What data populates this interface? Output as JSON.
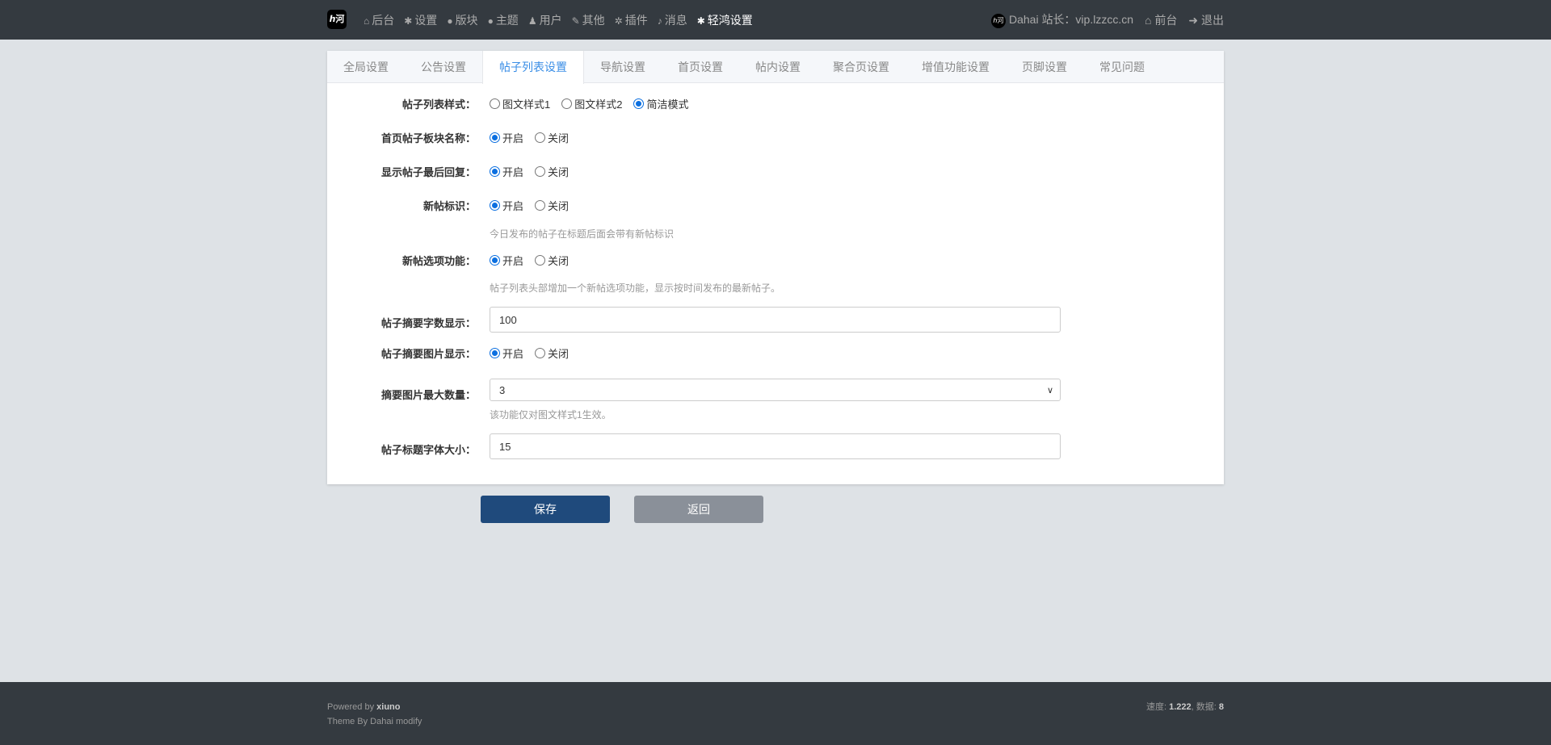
{
  "header": {
    "logo": "ℎ河",
    "nav": [
      {
        "icon": "home-icon",
        "glyph": "⌂",
        "label": "后台"
      },
      {
        "icon": "gear-icon",
        "glyph": "✱",
        "label": "设置"
      },
      {
        "icon": "comment-icon",
        "glyph": "●",
        "label": "版块"
      },
      {
        "icon": "comment-icon",
        "glyph": "●",
        "label": "主题"
      },
      {
        "icon": "user-icon",
        "glyph": "♟",
        "label": "用户"
      },
      {
        "icon": "wrench-icon",
        "glyph": "✎",
        "label": "其他"
      },
      {
        "icon": "cogs-icon",
        "glyph": "✲",
        "label": "插件"
      },
      {
        "icon": "bell-icon",
        "glyph": "♪",
        "label": "消息"
      },
      {
        "icon": "gear-icon",
        "glyph": "✱",
        "label": "轻鸿设置"
      }
    ],
    "user": "Dahai 站长：vip.lzzcc.cn",
    "front": "前台",
    "logout": "退出"
  },
  "tabs": [
    "全局设置",
    "公告设置",
    "帖子列表设置",
    "导航设置",
    "首页设置",
    "帖内设置",
    "聚合页设置",
    "增值功能设置",
    "页脚设置",
    "常见问题"
  ],
  "active_tab": "帖子列表设置",
  "form": {
    "list_style": {
      "label": "帖子列表样式：",
      "options": [
        "图文样式1",
        "图文样式2",
        "简洁模式"
      ],
      "selected": "简洁模式"
    },
    "home_forum_name": {
      "label": "首页帖子板块名称：",
      "options": [
        "开启",
        "关闭"
      ],
      "selected": "开启"
    },
    "last_reply": {
      "label": "显示帖子最后回复：",
      "options": [
        "开启",
        "关闭"
      ],
      "selected": "开启"
    },
    "new_badge": {
      "label": "新帖标识：",
      "options": [
        "开启",
        "关闭"
      ],
      "selected": "开启",
      "hint": "今日发布的帖子在标题后面会带有新帖标识"
    },
    "new_option": {
      "label": "新帖选项功能：",
      "options": [
        "开启",
        "关闭"
      ],
      "selected": "开启",
      "hint": "帖子列表头部增加一个新帖选项功能，显示按时间发布的最新帖子。"
    },
    "summary_chars": {
      "label": "帖子摘要字数显示：",
      "value": "100"
    },
    "summary_image": {
      "label": "帖子摘要图片显示：",
      "options": [
        "开启",
        "关闭"
      ],
      "selected": "开启"
    },
    "max_images": {
      "label": "摘要图片最大数量：",
      "value": "3",
      "hint": "该功能仅对图文样式1生效。"
    },
    "title_font": {
      "label": "帖子标题字体大小：",
      "value": "15"
    }
  },
  "buttons": {
    "save": "保存",
    "back": "返回"
  },
  "footer": {
    "powered": "Powered by ",
    "powered_name": "xiuno",
    "theme": "Theme By Dahai modify",
    "speed_label": "速度: ",
    "speed": "1.222",
    "data_label": ", 数据: ",
    "data": "8"
  },
  "colors": {
    "header": "#343a40",
    "accent": "#3a8ee6",
    "save": "#1f4a7c",
    "back": "#8a9099"
  }
}
